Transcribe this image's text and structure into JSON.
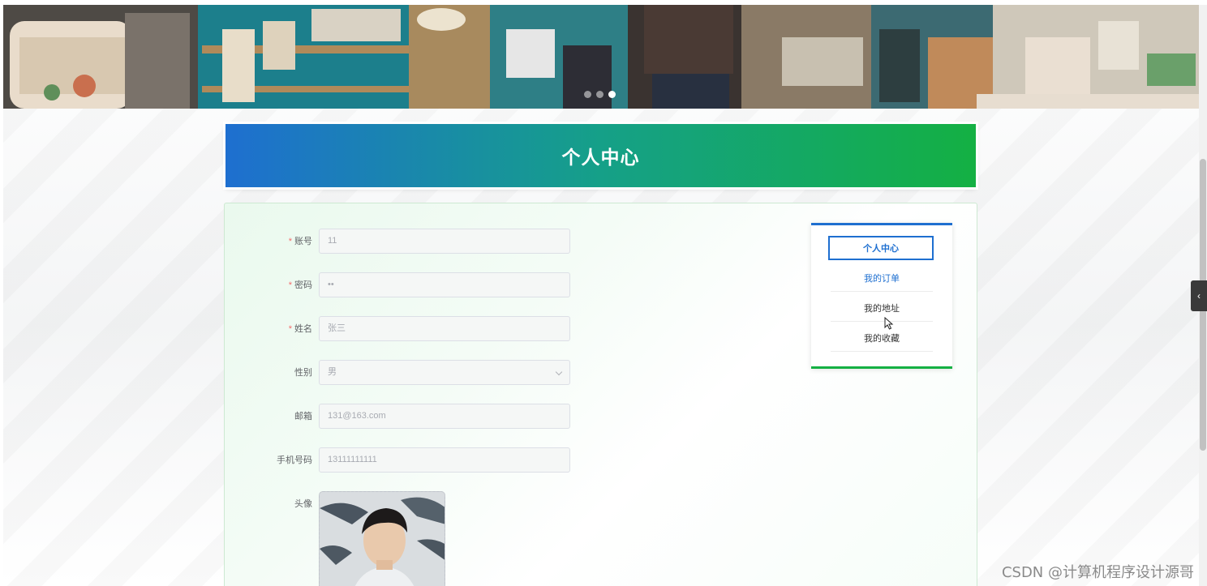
{
  "banner": {
    "slides": 3,
    "active_slide": 3
  },
  "page": {
    "title": "个人中心"
  },
  "form": {
    "account": {
      "label": "账号",
      "value": "11",
      "required": true
    },
    "password": {
      "label": "密码",
      "value": "••",
      "required": true
    },
    "name": {
      "label": "姓名",
      "value": "张三",
      "required": true
    },
    "gender": {
      "label": "性别",
      "value": "男",
      "required": false
    },
    "email": {
      "label": "邮箱",
      "value": "131@163.com",
      "required": false
    },
    "phone": {
      "label": "手机号码",
      "value": "13111111111",
      "required": false
    },
    "avatar": {
      "label": "头像"
    }
  },
  "side_menu": {
    "items": [
      {
        "label": "个人中心",
        "active": true
      },
      {
        "label": "我的订单",
        "active": false
      },
      {
        "label": "我的地址",
        "active": false
      },
      {
        "label": "我的收藏",
        "active": false
      }
    ]
  },
  "watermark": "CSDN @计算机程序设计源哥",
  "colors": {
    "title_gradient_start": "#1e6fd0",
    "title_gradient_end": "#14b043",
    "required_star": "#f56c6c",
    "menu_active": "#1e6fd0"
  }
}
